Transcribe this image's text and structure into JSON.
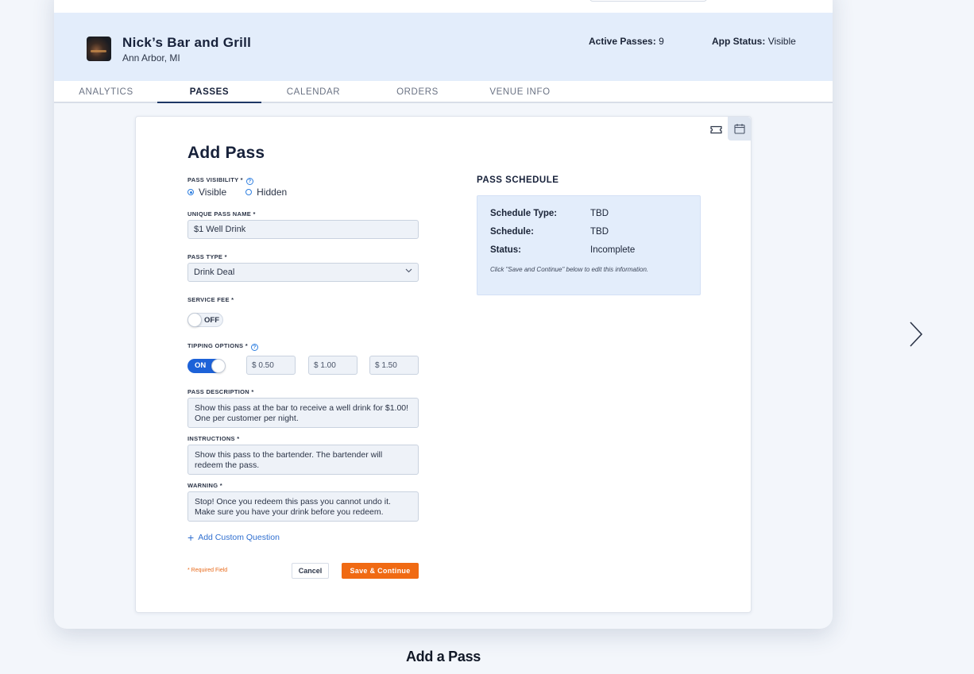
{
  "venue": {
    "name": "Nick’s Bar and Grill",
    "location": "Ann Arbor, MI",
    "active_passes_label": "Active  Passes:",
    "active_passes_value": "9",
    "app_status_label": "App Status:",
    "app_status_value": "Visible"
  },
  "tabs": [
    {
      "label": "ANALYTICS",
      "active": false
    },
    {
      "label": "PASSES",
      "active": true
    },
    {
      "label": "CALENDAR",
      "active": false
    },
    {
      "label": "ORDERS",
      "active": false
    },
    {
      "label": "VENUE INFO",
      "active": false
    }
  ],
  "card_icons": [
    "ticket-icon",
    "calendar-icon"
  ],
  "form": {
    "title": "Add Pass",
    "visibility": {
      "label": "PASS VISIBILITY *",
      "options": [
        "Visible",
        "Hidden"
      ],
      "selected": "Visible"
    },
    "name": {
      "label": "UNIQUE PASS NAME *",
      "value": "$1 Well Drink"
    },
    "type": {
      "label": "PASS TYPE *",
      "value": "Drink Deal"
    },
    "service_fee": {
      "label": "SERVICE FEE *",
      "state": "OFF"
    },
    "tipping": {
      "label": "TIPPING OPTIONS *",
      "state": "ON",
      "options": [
        "$ 0.50",
        "$ 1.00",
        "$ 1.50"
      ]
    },
    "description": {
      "label": "PASS DESCRIPTION *",
      "value": "Show this pass at the bar to receive a well drink for $1.00! One per customer per night."
    },
    "instructions": {
      "label": "INSTRUCTIONS *",
      "value": "Show this pass to the bartender. The bartender will redeem the pass."
    },
    "warning": {
      "label": "WARNING *",
      "value": "Stop! Once you redeem this pass you cannot undo it. Make sure you have your drink before you redeem."
    },
    "add_custom_question": "Add Custom Question",
    "required_note": "* Required Field",
    "cancel_label": "Cancel",
    "save_label": "Save & Continue"
  },
  "schedule": {
    "title": "PASS SCHEDULE",
    "rows": [
      {
        "key": "Schedule Type:",
        "value": "TBD"
      },
      {
        "key": "Schedule:",
        "value": "TBD"
      },
      {
        "key": "Status:",
        "value": "Incomplete"
      }
    ],
    "note": "Click \"Save and Continue\" below to edit this information."
  },
  "caption": "Add a Pass",
  "colors": {
    "accent_blue": "#1d62d8",
    "orange": "#f06a13",
    "header_bg": "#e3edfb",
    "navy": "#17213a"
  }
}
